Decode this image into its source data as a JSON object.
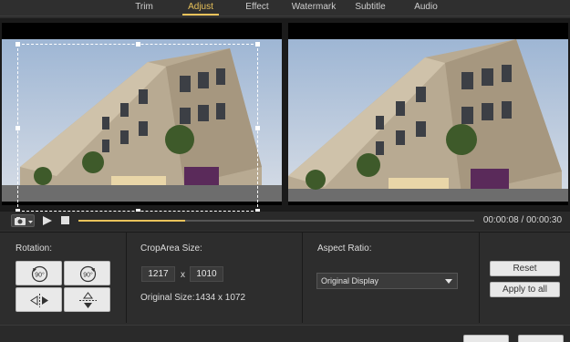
{
  "tabs": [
    "Trim",
    "Adjust",
    "Effect",
    "Watermark",
    "Subtitle",
    "Audio"
  ],
  "active_tab": "Adjust",
  "playback": {
    "time_display": "00:00:08 / 00:00:30",
    "progress": 0.27
  },
  "rotation": {
    "label": "Rotation:",
    "rotate_left_text": "90°",
    "rotate_right_text": "90°"
  },
  "crop": {
    "label": "CropArea Size:",
    "width": "1217",
    "separator": "x",
    "height": "1010",
    "original_label": "Original Size:",
    "original_value": "1434 x 1072"
  },
  "aspect": {
    "label": "Aspect Ratio:",
    "selected": "Original Display"
  },
  "buttons": {
    "reset": "Reset",
    "apply_all": "Apply to all"
  },
  "colors": {
    "accent": "#e8c25a",
    "background": "#2d2d2d"
  },
  "icons": [
    "camera-icon",
    "play-icon",
    "stop-icon",
    "rotate-left-icon",
    "rotate-right-icon",
    "flip-horizontal-icon",
    "flip-vertical-icon",
    "chevron-down-icon"
  ]
}
